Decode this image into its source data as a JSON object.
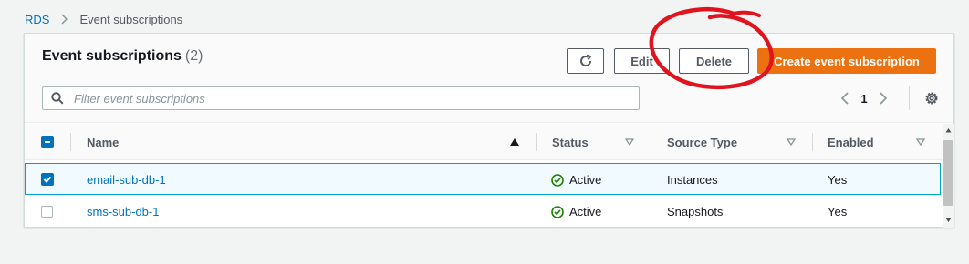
{
  "breadcrumb": {
    "root": "RDS",
    "current": "Event subscriptions"
  },
  "header": {
    "title": "Event subscriptions",
    "count": "(2)"
  },
  "toolbar": {
    "refresh_icon": "refresh-icon",
    "edit_label": "Edit",
    "delete_label": "Delete",
    "create_label": "Create event subscription"
  },
  "search": {
    "placeholder": "Filter event subscriptions",
    "value": ""
  },
  "pagination": {
    "current_page": "1"
  },
  "columns": [
    "Name",
    "Status",
    "Source Type",
    "Enabled"
  ],
  "rows": [
    {
      "name": "email-sub-db-1",
      "status": "Active",
      "source_type": "Instances",
      "enabled": "Yes",
      "selected": true
    },
    {
      "name": "sms-sub-db-1",
      "status": "Active",
      "source_type": "Snapshots",
      "enabled": "Yes",
      "selected": false
    }
  ],
  "colors": {
    "accent": "#ec7211",
    "link": "#0073bb",
    "success": "#1d8102",
    "annotation": "#e0141e"
  }
}
